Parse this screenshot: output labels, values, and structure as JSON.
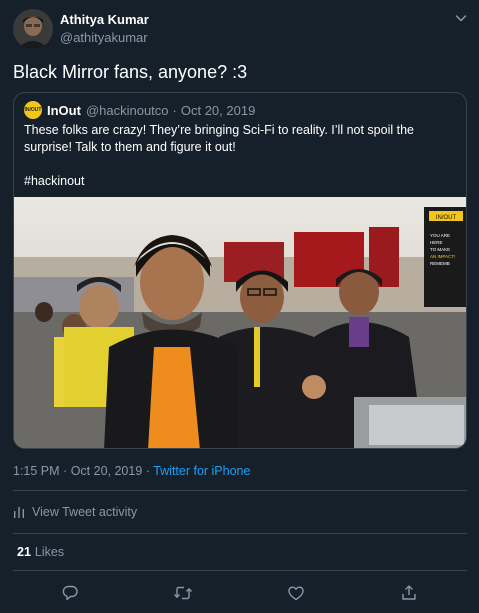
{
  "author": {
    "name": "Athitya Kumar",
    "handle": "@athityakumar",
    "avatar_icon": "profile-photo"
  },
  "tweet": {
    "text": "Black Mirror fans, anyone? :3"
  },
  "quote": {
    "avatar_label": "IN/OUT",
    "name": "InOut",
    "handle": "@hackinoutco",
    "separator": "·",
    "date": "Oct 20, 2019",
    "text_line1": "These folks are crazy! They’re bringing Sci-Fi to reality. I’ll not spoil the surprise! Talk to them and figure it out!",
    "hashtag": "#hackinout",
    "photo_banner_brand": "IN/OUT",
    "photo_banner_lines": [
      "YOU ARE",
      "HERE",
      "TO MAKE",
      "AN IMPACT!",
      "REMEMB"
    ]
  },
  "timestamp": {
    "time": "1:15 PM",
    "separator1": "·",
    "date": "Oct 20, 2019",
    "separator2": "·",
    "source": "Twitter for iPhone"
  },
  "activity": {
    "label": "View Tweet activity",
    "icon": "bar-chart-icon"
  },
  "likes": {
    "count": "21",
    "label": "Likes"
  },
  "actions": [
    "reply-icon",
    "retweet-icon",
    "like-icon",
    "share-icon"
  ],
  "colors": {
    "background": "#15202b",
    "border": "#38444d",
    "secondary_text": "#8899a6",
    "link": "#1da1f2",
    "inout_yellow": "#f3c61a"
  }
}
